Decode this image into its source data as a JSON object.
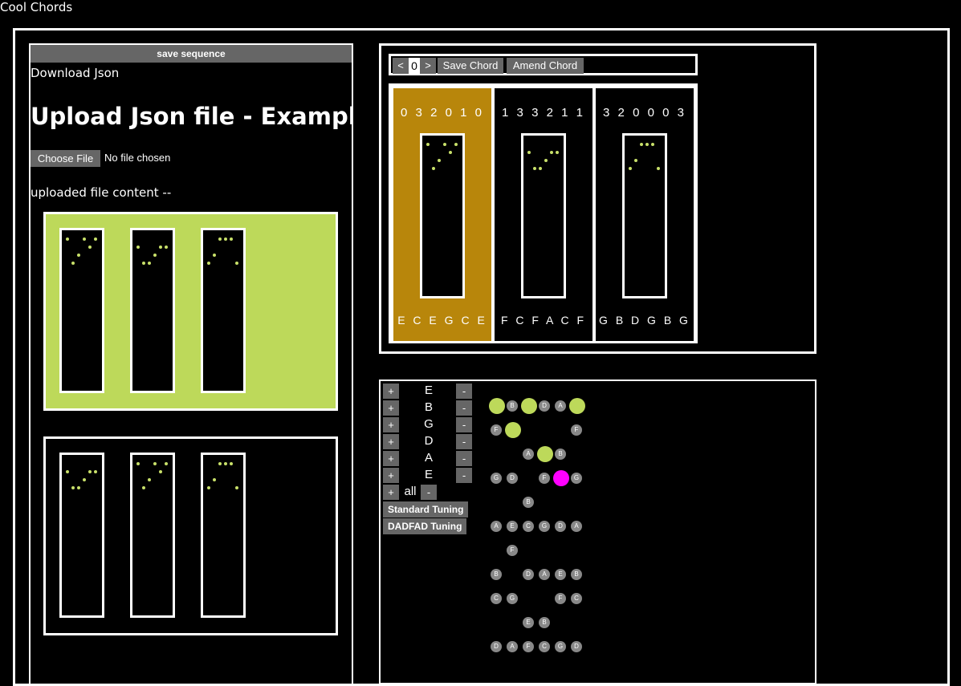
{
  "app": {
    "title": "Cool Chords"
  },
  "left": {
    "save_sequence": "save sequence",
    "download_json": "Download Json",
    "upload_title": "Upload Json file - Example",
    "choose_file": "Choose File",
    "no_file": "No file chosen",
    "uploaded_label": "uploaded file content --"
  },
  "toolbar": {
    "prev": "<",
    "index": "0",
    "next": ">",
    "save_chord": "Save Chord",
    "amend_chord": "Amend Chord"
  },
  "chords": [
    {
      "frets": "0 3 2 0 1 0",
      "notes": "E C E G C E",
      "selected": true
    },
    {
      "frets": "1 3 3 2 1 1",
      "notes": "F C F A C F",
      "selected": false
    },
    {
      "frets": "3 2 0 0 0 3",
      "notes": "G B D G B G",
      "selected": false
    }
  ],
  "strings": [
    "E",
    "B",
    "G",
    "D",
    "A",
    "E"
  ],
  "string_controls": {
    "plus": "+",
    "minus": "-",
    "all": "all"
  },
  "tunings": {
    "standard": "Standard Tuning",
    "dadfad": "DADFAD Tuning"
  },
  "fretboard_rows": [
    [
      "",
      "B",
      "",
      "D",
      "A",
      ""
    ],
    [
      "F",
      "",
      "",
      "",
      "",
      "F"
    ],
    [
      "",
      "",
      "A",
      "",
      "B",
      ""
    ],
    [
      "G",
      "D",
      "",
      "F",
      "",
      "G"
    ],
    [
      "",
      "",
      "B",
      "",
      "",
      ""
    ],
    [
      "A",
      "E",
      "C",
      "G",
      "D",
      "A"
    ],
    [
      "",
      "F",
      "",
      "",
      "",
      ""
    ],
    [
      "B",
      "",
      "D",
      "A",
      "E",
      "B"
    ],
    [
      "C",
      "G",
      "",
      "",
      "F",
      "C"
    ],
    [
      "",
      "",
      "E",
      "B",
      "",
      ""
    ],
    [
      "D",
      "A",
      "F",
      "C",
      "G",
      "D"
    ]
  ],
  "colors": {
    "accent_green": "#bdd95a",
    "selected_gold": "#b8860b",
    "highlight_magenta": "#ff00ff",
    "button_gray": "#666666"
  }
}
